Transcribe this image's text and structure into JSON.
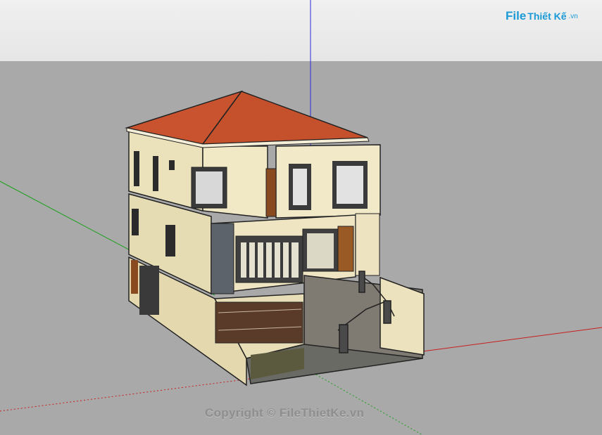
{
  "watermark": {
    "logo_part1": "File",
    "logo_part2": "Thiết Kế",
    "logo_tld": ".vn",
    "copyright": "Copyright © FileThietKe.vn"
  },
  "colors": {
    "sky": "#ececec",
    "ground": "#a9a9a9",
    "roof": "#c4502c",
    "wall": "#ede3c0",
    "axis_blue": "#2a2ad6",
    "axis_red": "#c81e1e",
    "axis_green": "#1ea01e",
    "brand": "#1a9ad6"
  }
}
